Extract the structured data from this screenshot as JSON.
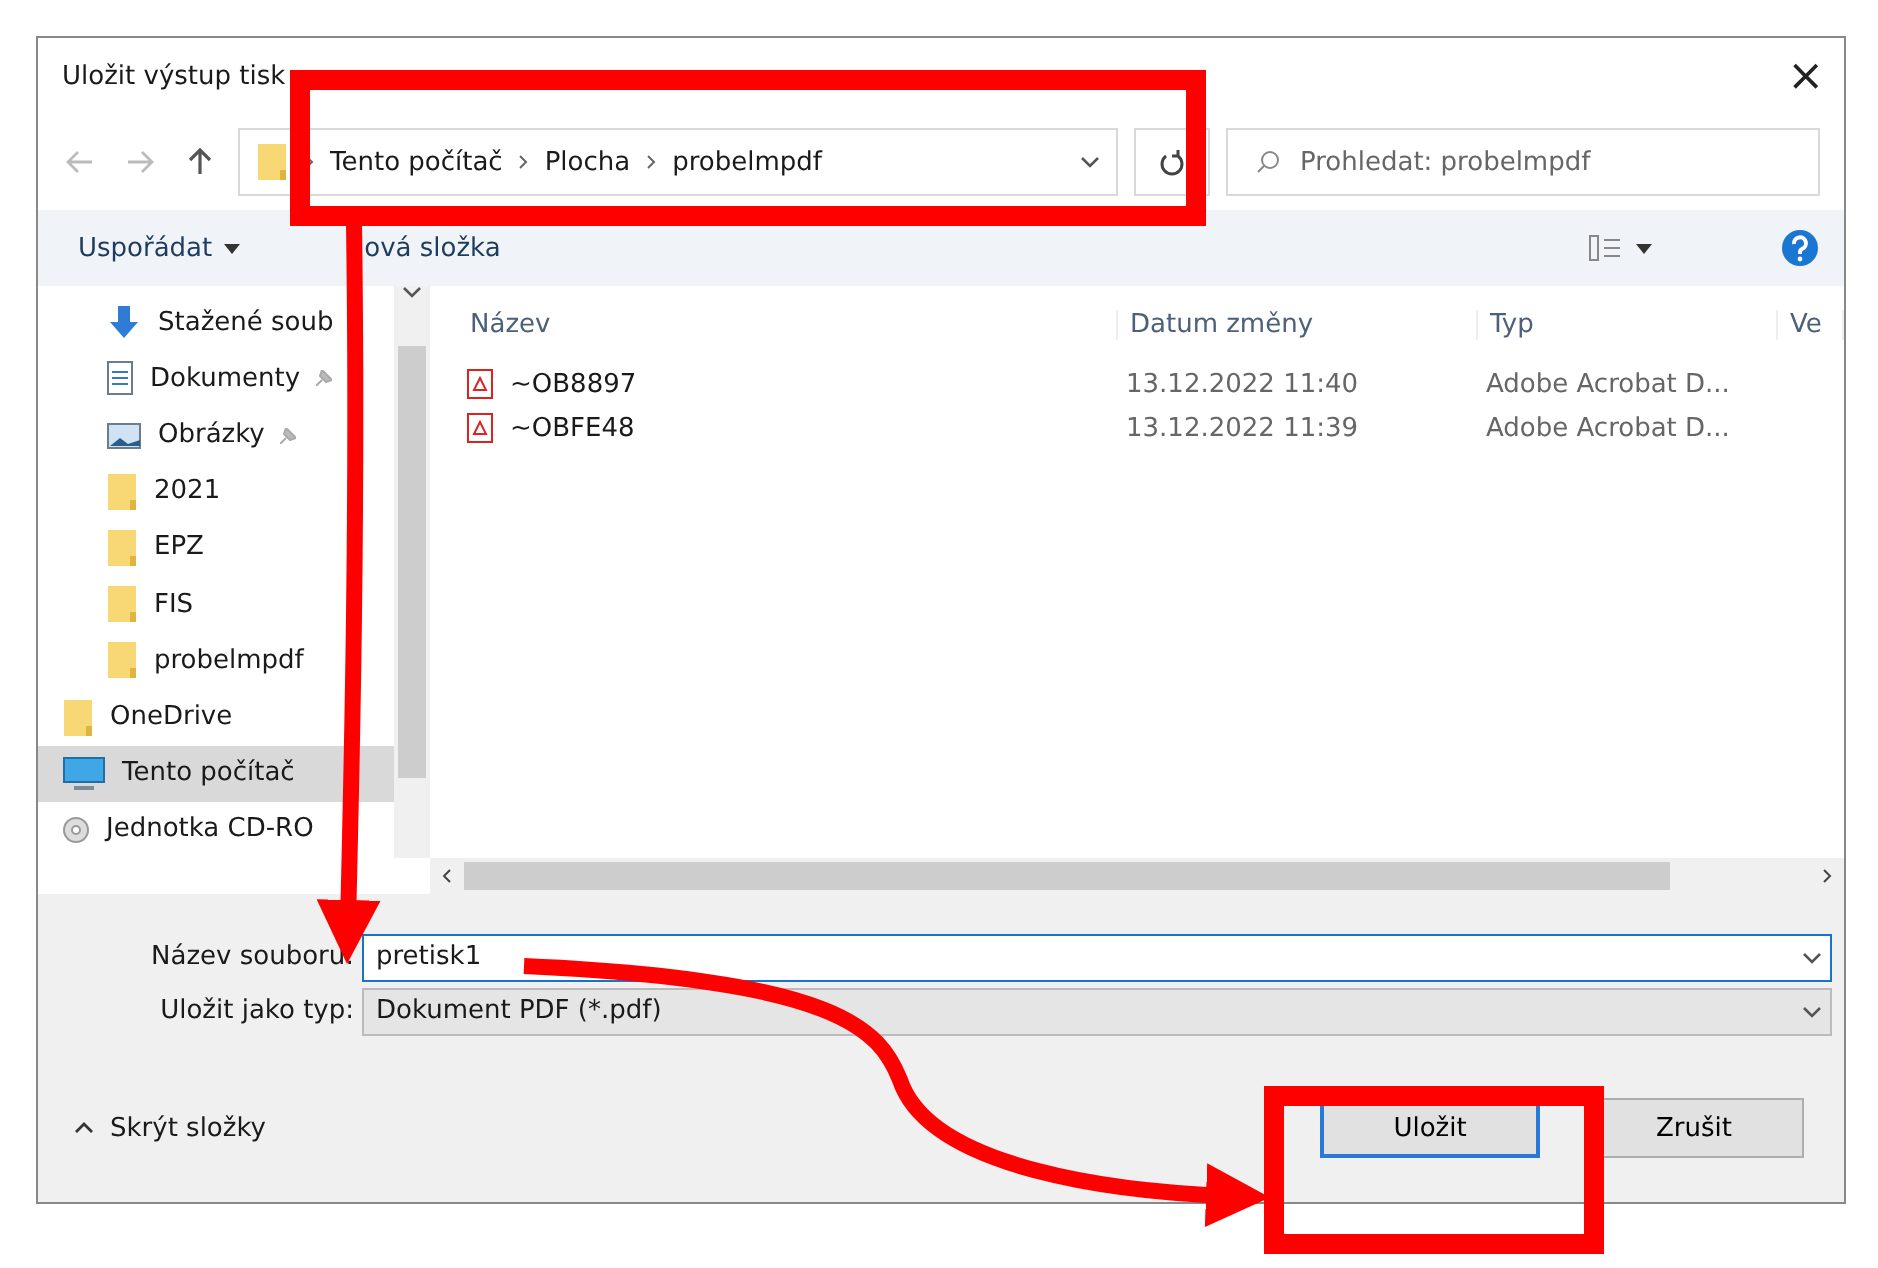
{
  "window": {
    "title": "Uložit výstup tisk",
    "close": "×"
  },
  "nav": {
    "path": [
      "Tento počítač",
      "Plocha",
      "probelmpdf"
    ],
    "search": {
      "placeholder": "Prohledat: probelmpdf"
    }
  },
  "toolbar": {
    "organize": "Uspořádat",
    "new_folder": "ová složka"
  },
  "sidebar": {
    "items": [
      {
        "label": "Stažené soub",
        "kind": "download",
        "selected": false
      },
      {
        "label": "Dokumenty",
        "kind": "document",
        "selected": false
      },
      {
        "label": "Obrázky",
        "kind": "image",
        "selected": false
      },
      {
        "label": "2021",
        "kind": "folder",
        "selected": false
      },
      {
        "label": "EPZ",
        "kind": "folder",
        "selected": false
      },
      {
        "label": "FIS",
        "kind": "folder",
        "selected": false
      },
      {
        "label": "probelmpdf",
        "kind": "folder",
        "selected": false
      },
      {
        "label": "OneDrive",
        "kind": "root-folder",
        "selected": false
      },
      {
        "label": "Tento počítač",
        "kind": "computer",
        "selected": true
      },
      {
        "label": "Jednotka CD-RO",
        "kind": "disc",
        "selected": false
      }
    ]
  },
  "table": {
    "columns": [
      "Název",
      "Datum změny",
      "Typ",
      "Ve"
    ],
    "rows": [
      {
        "name": "~OB8897",
        "date": "13.12.2022 11:40",
        "type": "Adobe Acrobat D..."
      },
      {
        "name": "~OBFE48",
        "date": "13.12.2022 11:39",
        "type": "Adobe Acrobat D..."
      }
    ]
  },
  "form": {
    "filename_label": "Název souboru:",
    "filename": "pretisk1",
    "type_label": "Uložit jako typ:",
    "type": "Dokument PDF (*.pdf)"
  },
  "footer": {
    "hide_folders": "Skrýt složky",
    "buttons": [
      {
        "label": "Uložit",
        "primary": true
      },
      {
        "label": "Zrušit",
        "primary": false
      }
    ]
  }
}
